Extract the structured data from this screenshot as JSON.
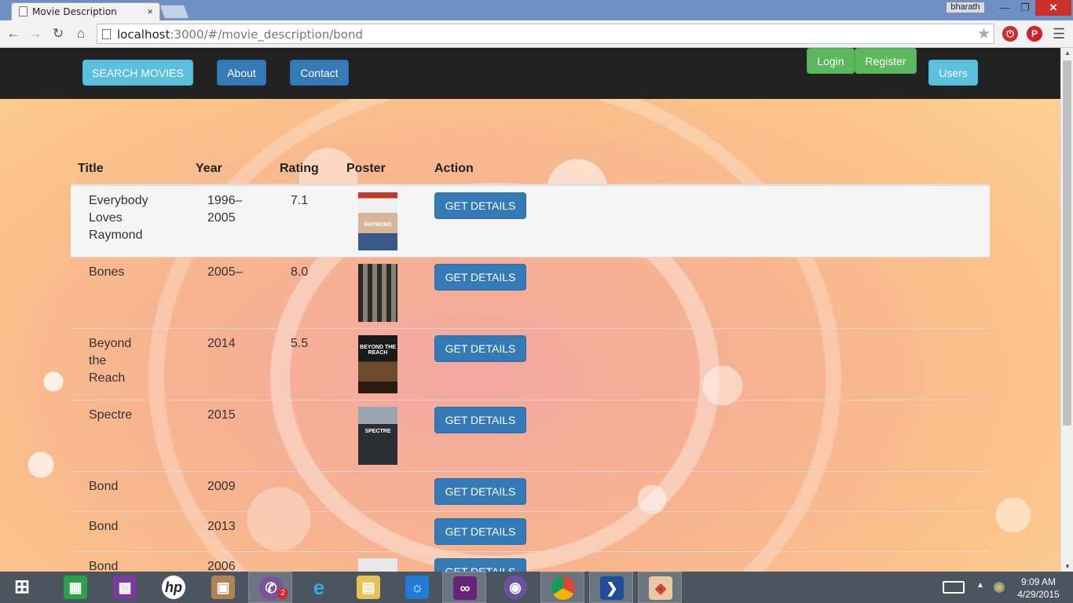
{
  "browser": {
    "tab_title": "Movie Description",
    "tab_close": "×",
    "user_badge": "bharath",
    "url_host": "localhost",
    "url_path": ":3000/#/movie_description/bond"
  },
  "navbar": {
    "search": "SEARCH MOVIES",
    "about": "About",
    "contact": "Contact",
    "login": "Login",
    "register": "Register",
    "users": "Users"
  },
  "table": {
    "headers": {
      "title": "Title",
      "year": "Year",
      "rating": "Rating",
      "poster": "Poster",
      "action": "Action"
    },
    "action_label": "GET DETAILS",
    "rows": [
      {
        "title": "Everybody Loves Raymond",
        "year": "1996–2005",
        "rating": "7.1",
        "has_poster": true,
        "poster_text": "RAYMOND"
      },
      {
        "title": "Bones",
        "year": "2005–",
        "rating": "8.0",
        "has_poster": true,
        "poster_text": ""
      },
      {
        "title": "Beyond the Reach",
        "year": "2014",
        "rating": "5.5",
        "has_poster": true,
        "poster_text": "BEYOND THE REACH"
      },
      {
        "title": "Spectre",
        "year": "2015",
        "rating": "",
        "has_poster": true,
        "poster_text": "SPECTRE"
      },
      {
        "title": "Bond",
        "year": "2009",
        "rating": "",
        "has_poster": false,
        "poster_text": ""
      },
      {
        "title": "Bond",
        "year": "2013",
        "rating": "",
        "has_poster": false,
        "poster_text": ""
      },
      {
        "title": "Bond",
        "year": "2006",
        "rating": "",
        "has_poster": true,
        "poster_text": ""
      }
    ]
  },
  "taskbar": {
    "viber_badge": "2",
    "time": "9:09 AM",
    "date": "4/29/2015"
  }
}
